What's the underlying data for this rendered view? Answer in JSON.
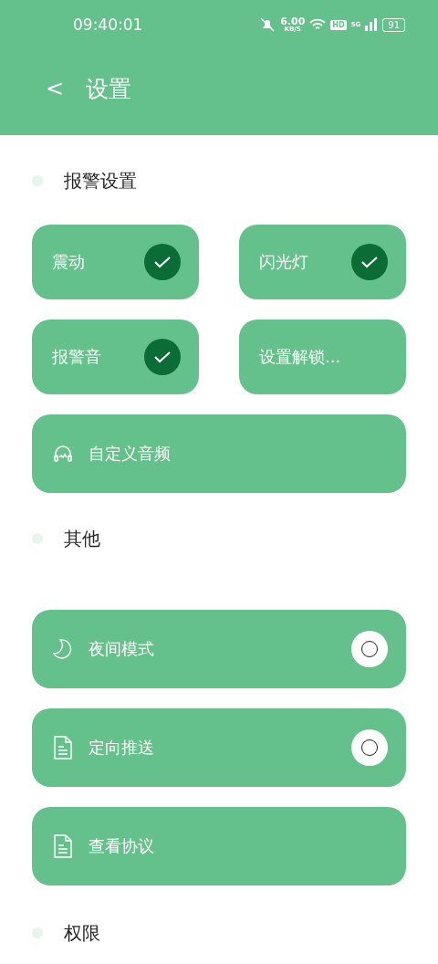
{
  "status_bar": {
    "time": "09:40:01",
    "speed": "6.00",
    "speed_unit": "KB/S",
    "hd": "HD",
    "network": "5G",
    "battery": "91"
  },
  "header": {
    "back": "<",
    "title": "设置"
  },
  "sections": [
    {
      "title": "报警设置",
      "grid": [
        {
          "label": "震动",
          "kind": "check",
          "checked": true
        },
        {
          "label": "闪光灯",
          "kind": "check",
          "checked": true
        },
        {
          "label": "报警音",
          "kind": "check",
          "checked": true
        },
        {
          "label": "设置解锁...",
          "kind": "plain"
        }
      ],
      "rows": [
        {
          "label": "自定义音频",
          "kind": "plain"
        }
      ]
    },
    {
      "title": "其他",
      "rows": [
        {
          "label": "夜间模式",
          "kind": "radio",
          "checked": false
        },
        {
          "label": "定向推送",
          "kind": "radio",
          "checked": false
        },
        {
          "label": "查看协议",
          "kind": "plain"
        }
      ]
    },
    {
      "title": "权限"
    }
  ]
}
